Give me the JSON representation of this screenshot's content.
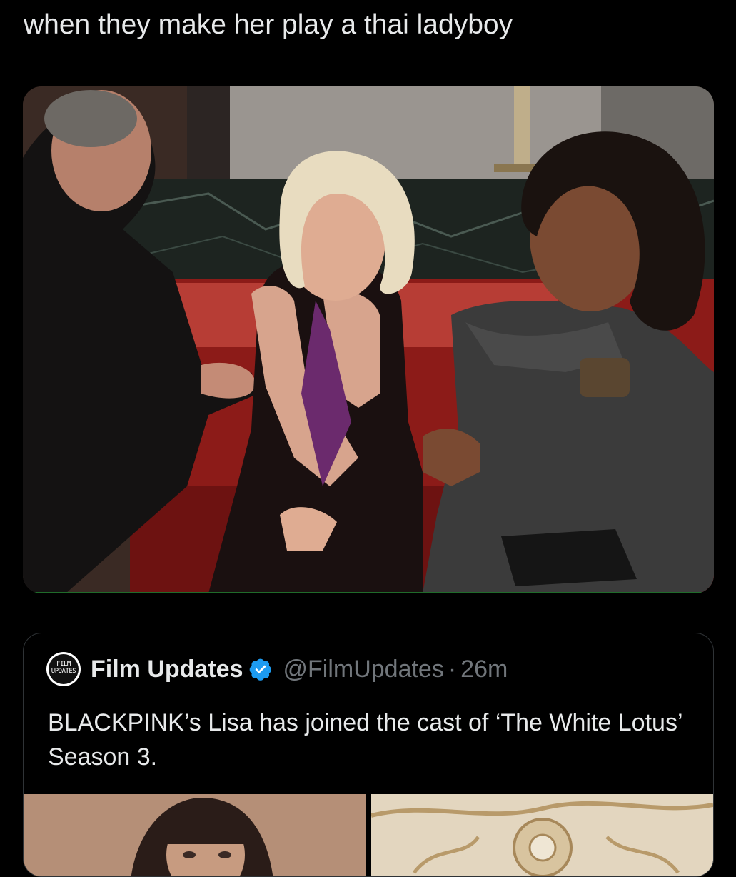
{
  "tweet": {
    "text": "when they make her play a thai ladyboy"
  },
  "quote": {
    "avatar_text_line1": "FILM",
    "avatar_text_line2": "UPDATES",
    "display_name": "Film Updates",
    "handle": "@FilmUpdates",
    "separator": "·",
    "time": "26m",
    "text": "BLACKPINK’s Lisa has joined the cast of ‘The White Lotus’ Season 3."
  },
  "icons": {
    "verified": "verified-badge-icon"
  },
  "colors": {
    "background": "#000000",
    "text_primary": "#e7e9ea",
    "text_secondary": "#71767b",
    "verified_blue": "#1d9bf0",
    "card_border": "#2f3336"
  }
}
